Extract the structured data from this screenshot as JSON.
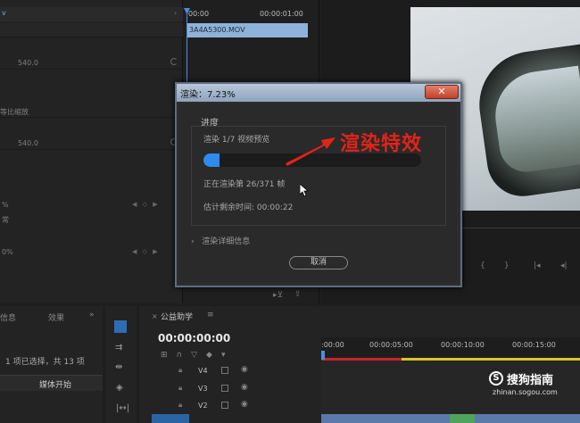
{
  "effect_controls": {
    "timecode_start": "00:00",
    "timecode_end": "00:00:01:00",
    "clip_name": "3A4A5300.MOV",
    "rows": [
      {
        "value": "540.0"
      },
      {
        "value": "等比缩放"
      },
      {
        "value": "540.0"
      }
    ],
    "percent_1": "%",
    "blend": "常",
    "percent_2": "0%"
  },
  "render_dialog": {
    "title": "渲染：7.23%",
    "close_symbol": "✕",
    "progress_label": "进度",
    "render_step": "渲染 1/7 视频预览",
    "progress_fraction": 0.0723,
    "frame_text": "正在渲染第 26/371 帧",
    "time_remaining": "估计剩余时间: 00:00:22",
    "details_label": "渲染详细信息",
    "cancel_label": "取消"
  },
  "annotation": {
    "text": "渲染特效",
    "color": "#e2231a"
  },
  "project_panel": {
    "tab_info": "信息",
    "tab_effects": "效果",
    "selection_text": "1 项已选择，共 13 项",
    "column_header": "媒体开始"
  },
  "timeline": {
    "sequence_name": "公益助学",
    "timecode": "00:00:00:00",
    "ruler_labels": [
      ":00:00",
      "00:00:05:00",
      "00:00:10:00",
      "00:00:15:00"
    ],
    "tracks": [
      "V4",
      "V3",
      "V2"
    ]
  },
  "watermark": {
    "brand": "搜狗指南",
    "url": "zhinan.sogou.com"
  },
  "colors": {
    "accent_blue": "#2d8ceb",
    "titlebar": "#8ea4bd"
  }
}
